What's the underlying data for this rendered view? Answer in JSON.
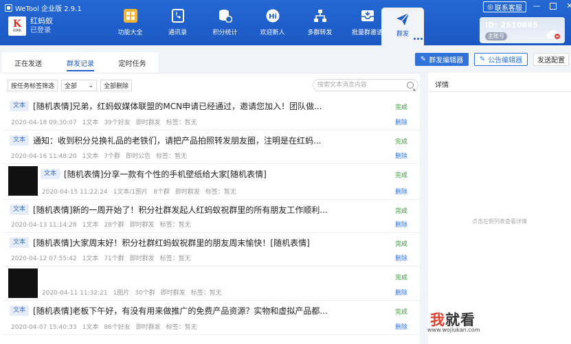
{
  "app": {
    "title": "WeTool 企业版 2.9.1"
  },
  "user": {
    "name": "红蚂蚁",
    "status": "已登录",
    "avatar_text": "K",
    "avatar_sub": "IDRK"
  },
  "nav": [
    {
      "label": "功能大全",
      "icon": "grid-icon"
    },
    {
      "label": "通讯录",
      "icon": "phone-book-icon"
    },
    {
      "label": "积分统计",
      "icon": "coins-icon"
    },
    {
      "label": "欢迎新人",
      "icon": "hi-icon"
    },
    {
      "label": "多群转发",
      "icon": "network-icon"
    },
    {
      "label": "批量群邀请",
      "icon": "inbox-icon"
    }
  ],
  "nav_active": {
    "label": "群发",
    "icon": "send-icon"
  },
  "window": {
    "service_label": "联系客服"
  },
  "account": {
    "id_label": "ID: 2510885",
    "badge": "主账号"
  },
  "tabs": [
    "正在发送",
    "群发记录",
    "定时任务"
  ],
  "toolbar": {
    "mass_editor": "群发编辑器",
    "notice_editor": "公告编辑器",
    "send_config": "发送配置"
  },
  "filters": {
    "tag_filter": "按任务标签筛选",
    "all_select": "全部",
    "delete_all": "全部删除",
    "search_placeholder": "搜索文本消息内容"
  },
  "records": [
    {
      "tag": "文本",
      "text": "[随机表情]兄弟，红蚂蚁媒体联盟的MCN申请已经通过，邀请您加入！团队做...",
      "meta": [
        "2020-04-18 09:30:07",
        "1文本",
        "39个好友",
        "即时群发",
        "标签：暂无"
      ],
      "status": "完成",
      "action": "删除",
      "thumb": false
    },
    {
      "tag": "文本",
      "text": "通知：收到积分兑换礼品的老铁们，请把产品拍照转发朋友圈，注明是在红蚂...",
      "meta": [
        "2020-04-16 11:48:20",
        "1文本",
        "7个群",
        "即时公告",
        "标签：暂无"
      ],
      "status": "完成",
      "action": "删除",
      "thumb": false
    },
    {
      "tag": "文本",
      "text": "[随机表情]分享一款有个性的手机壁纸给大家[随机表情]",
      "meta": [
        "2020-04-15 11:22:24",
        "1文本/1图片",
        "8个群",
        "即时群发",
        "标签：暂无"
      ],
      "status": "完成",
      "action": "删除",
      "thumb": true
    },
    {
      "tag": "文本",
      "text": "[随机表情]新的一周开始了！积分社群发起人红蚂蚁祝群里的所有朋友工作顺利...",
      "meta": [
        "2020-04-13 11:14:28",
        "1文本",
        "28个群",
        "即时群发",
        "标签：暂无"
      ],
      "status": "完成",
      "action": "删除",
      "thumb": false
    },
    {
      "tag": "文本",
      "text": "[随机表情]大家周末好！积分社群红蚂蚁祝群里的朋友周末愉快！[随机表情]",
      "meta": [
        "2020-04-12 07:55:42",
        "1文本",
        "71个群",
        "即时群发",
        "标签：暂无"
      ],
      "status": "完成",
      "action": "删除",
      "thumb": false
    },
    {
      "tag": "",
      "text": "",
      "meta": [
        "2020-04-11 11:32:21",
        "1图片",
        "30个群",
        "即时群发",
        "标签：暂无"
      ],
      "status": "完成",
      "action": "删除",
      "thumb": true
    },
    {
      "tag": "文本",
      "text": "[随机表情]老板下午好，有没有用来做推广的免费产品资源？实物和虚拟产品都...",
      "meta": [
        "2020-04-07 15:40:33",
        "1文本",
        "86个好友",
        "即时群发",
        "标签：暂无"
      ],
      "status": "完成",
      "action": "删除",
      "thumb": false
    }
  ],
  "detail": {
    "title": "详情",
    "empty_hint": "点击左侧列表查看详情"
  },
  "watermark": {
    "big_1": "我",
    "big_2": "就看",
    "small": "www.wojiukan.com"
  },
  "colors": {
    "primary": "#1f5fcc",
    "success": "#2aa52a",
    "header": "#2468d4"
  }
}
